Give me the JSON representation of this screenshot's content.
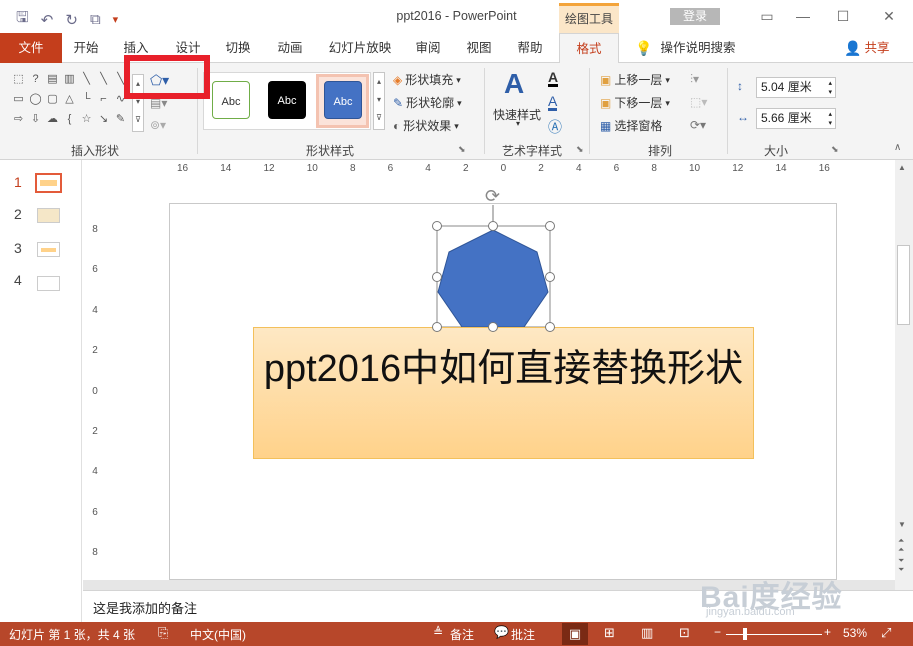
{
  "window": {
    "title": "ppt2016  -  PowerPoint",
    "context_tab": "绘图工具",
    "login": "登录"
  },
  "tabs": {
    "file": "文件",
    "home": "开始",
    "insert": "插入",
    "design": "设计",
    "transitions": "切换",
    "animations": "动画",
    "slideshow": "幻灯片放映",
    "review": "审阅",
    "view": "视图",
    "help": "帮助",
    "format": "格式",
    "tell_me": "操作说明搜索",
    "share": "共享"
  },
  "ribbon": {
    "insert_shapes_label": "插入形状",
    "shape_styles_label": "形状样式",
    "style_presets": [
      "Abc",
      "Abc",
      "Abc"
    ],
    "shape_fill": "形状填充",
    "shape_outline": "形状轮廓",
    "shape_effects": "形状效果",
    "quick_styles": "快速样式",
    "art_label": "艺术字样式",
    "bring_forward": "上移一层",
    "send_backward": "下移一层",
    "selection_pane": "选择窗格",
    "arrange_label": "排列",
    "height": "5.04 厘米",
    "width": "5.66 厘米",
    "size_label": "大小"
  },
  "slides": [
    "1",
    "2",
    "3",
    "4"
  ],
  "ruler_h": [
    "16",
    "14",
    "12",
    "10",
    "8",
    "6",
    "4",
    "2",
    "0",
    "2",
    "4",
    "6",
    "8",
    "10",
    "12",
    "14",
    "16"
  ],
  "ruler_v": [
    "8",
    "6",
    "4",
    "2",
    "0",
    "2",
    "4",
    "6",
    "8"
  ],
  "slide_text": "ppt2016中如何直接替换形状",
  "notes": "这是我添加的备注",
  "status": {
    "slide_info": "幻灯片 第 1 张，共 4 张",
    "language": "中文(中国)",
    "notes_btn": "备注",
    "comments_btn": "批注",
    "zoom": "53%"
  },
  "watermark": {
    "brand": "Bai度经验",
    "url": "jingyan.baidu.com"
  },
  "colors": {
    "accent": "#c43e1c",
    "shape_fill": "#4472c4",
    "highlight": "#e8202a"
  }
}
